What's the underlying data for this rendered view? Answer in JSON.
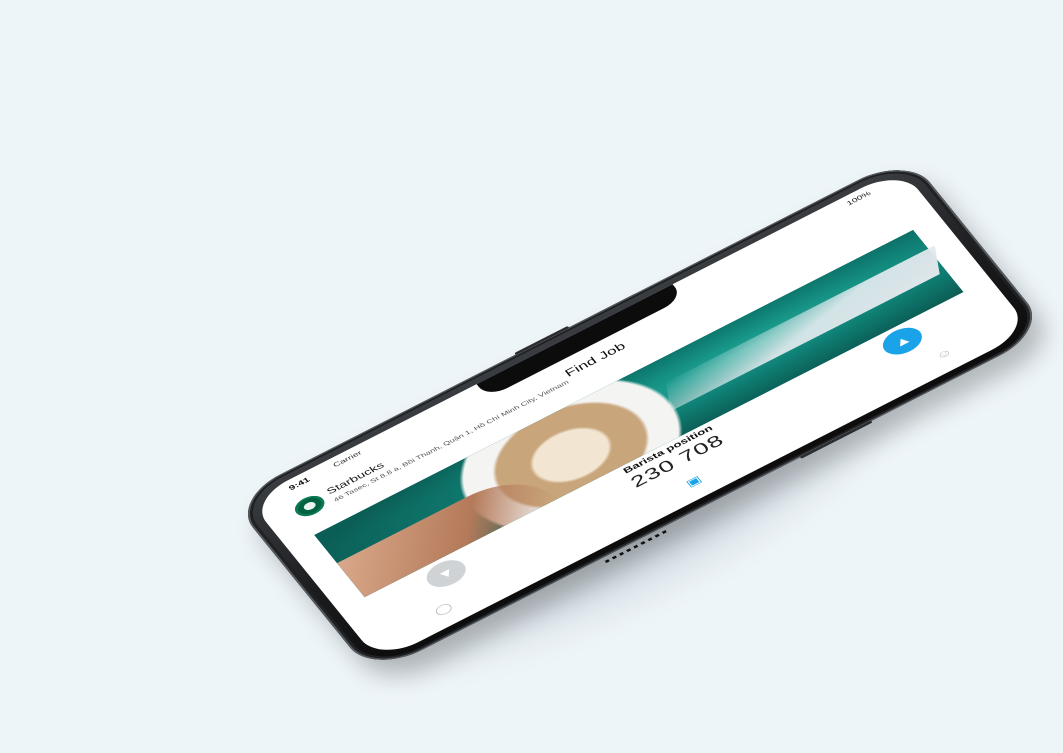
{
  "status_bar": {
    "time": "9:41",
    "carrier": "Carrier",
    "battery": "100%"
  },
  "header": {
    "title": "Find Job",
    "brand_name": "Starbucks",
    "brand_address": "46 Tasec, St 8.8 a, Bồi Thạnh, Quận 1, Hồ Chí Minh City, Vietnam"
  },
  "job": {
    "title": "Barista position",
    "salary": "230 708"
  },
  "actions": {
    "dislike_icon": "thumbs-down-icon",
    "like_icon": "thumbs-up-icon"
  },
  "tabbar": {
    "items": [
      {
        "icon": "chat-icon",
        "active": false
      },
      {
        "icon": "cards-icon",
        "active": true
      },
      {
        "icon": "profile-icon",
        "active": false
      }
    ]
  },
  "colors": {
    "accent": "#1aa3e8",
    "background": "#eef5f9",
    "brand": "#006241"
  }
}
